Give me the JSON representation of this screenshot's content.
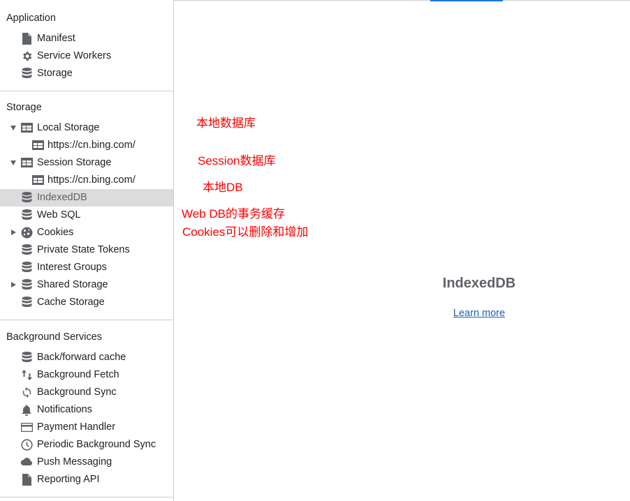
{
  "sidebar": {
    "application": {
      "title": "Application",
      "items": [
        {
          "label": "Manifest",
          "icon": "document-icon"
        },
        {
          "label": "Service Workers",
          "icon": "gear-icon"
        },
        {
          "label": "Storage",
          "icon": "database-icon"
        }
      ]
    },
    "storage": {
      "title": "Storage",
      "items": [
        {
          "label": "Local Storage",
          "icon": "table-icon",
          "expanded": true
        },
        {
          "label": "https://cn.bing.com/",
          "icon": "table-icon"
        },
        {
          "label": "Session Storage",
          "icon": "table-icon",
          "expanded": true
        },
        {
          "label": "https://cn.bing.com/",
          "icon": "table-icon"
        },
        {
          "label": "IndexedDB",
          "icon": "database-icon",
          "selected": true
        },
        {
          "label": "Web SQL",
          "icon": "database-icon"
        },
        {
          "label": "Cookies",
          "icon": "cookie-icon",
          "expanded": false
        },
        {
          "label": "Private State Tokens",
          "icon": "database-icon"
        },
        {
          "label": "Interest Groups",
          "icon": "database-icon"
        },
        {
          "label": "Shared Storage",
          "icon": "database-icon",
          "expanded": false
        },
        {
          "label": "Cache Storage",
          "icon": "database-icon"
        }
      ]
    },
    "background_services": {
      "title": "Background Services",
      "items": [
        {
          "label": "Back/forward cache",
          "icon": "database-icon"
        },
        {
          "label": "Background Fetch",
          "icon": "up-down-arrows-icon"
        },
        {
          "label": "Background Sync",
          "icon": "sync-icon"
        },
        {
          "label": "Notifications",
          "icon": "bell-icon"
        },
        {
          "label": "Payment Handler",
          "icon": "credit-card-icon"
        },
        {
          "label": "Periodic Background Sync",
          "icon": "clock-icon"
        },
        {
          "label": "Push Messaging",
          "icon": "cloud-icon"
        },
        {
          "label": "Reporting API",
          "icon": "document-icon"
        }
      ]
    }
  },
  "annotations": [
    "本地数据库",
    "Session数据库",
    "本地DB",
    "Web DB的事务缓存",
    "Cookies可以删除和增加"
  ],
  "main": {
    "title": "IndexedDB",
    "learn_more": "Learn more"
  },
  "colors": {
    "accent": "#1a73e8",
    "annotation": "#ff0000",
    "selected_bg": "#dcdcdc",
    "icon": "#5f6368"
  }
}
